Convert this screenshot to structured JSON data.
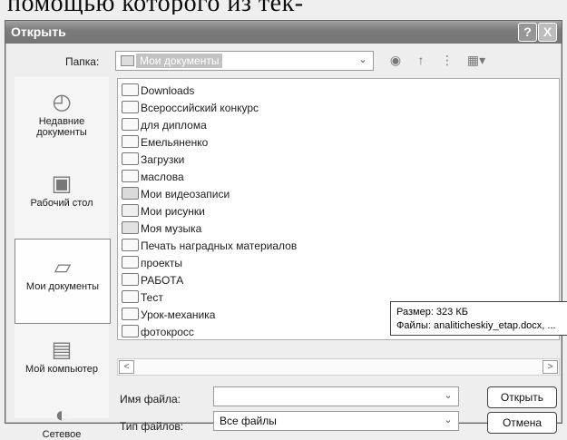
{
  "page_caption": "помощью которого из тек-",
  "window": {
    "title": "Открыть",
    "help_label": "?",
    "close_label": "X"
  },
  "folder": {
    "label": "Папка:",
    "value": "Мои документы"
  },
  "toolbar": {
    "back_icon": "back-icon",
    "up_icon": "up-folder-icon",
    "new_folder_icon": "new-folder-icon",
    "views_icon": "views-menu-icon"
  },
  "places": [
    {
      "label": "Недавние документы"
    },
    {
      "label": "Рабочий стол"
    },
    {
      "label": "Мои документы"
    },
    {
      "label": "Мой компьютер"
    },
    {
      "label": "Сетевое"
    }
  ],
  "files": [
    {
      "name": "Downloads",
      "icon": "folder-icon"
    },
    {
      "name": "Всероссийский конкурс",
      "icon": "folder-icon"
    },
    {
      "name": "для диплома",
      "icon": "folder-icon"
    },
    {
      "name": "Емельяненко",
      "icon": "folder-icon"
    },
    {
      "name": "Загрузки",
      "icon": "folder-icon"
    },
    {
      "name": "маслова",
      "icon": "folder-icon"
    },
    {
      "name": "Мои видеозаписи",
      "icon": "video-folder-icon"
    },
    {
      "name": "Мои рисунки",
      "icon": "pictures-folder-icon"
    },
    {
      "name": "Моя музыка",
      "icon": "music-folder-icon"
    },
    {
      "name": "Печать наградных материалов",
      "icon": "folder-icon"
    },
    {
      "name": "проекты",
      "icon": "folder-icon"
    },
    {
      "name": "РАБОТА",
      "icon": "folder-icon"
    },
    {
      "name": "Тест",
      "icon": "folder-icon"
    },
    {
      "name": "Урок-механика",
      "icon": "folder-icon"
    },
    {
      "name": "фотокросс",
      "icon": "folder-icon"
    }
  ],
  "tooltip": {
    "line1": "Размер: 323 КБ",
    "line2": "Файлы: analiticheskiy_etap.docx, ..."
  },
  "filename": {
    "label": "Имя файла:",
    "value": ""
  },
  "filetype": {
    "label": "Тип файлов:",
    "value": "Все файлы"
  },
  "buttons": {
    "open": "Открыть",
    "cancel": "Отмена"
  },
  "scroll": {
    "left": "<",
    "right": ">"
  }
}
